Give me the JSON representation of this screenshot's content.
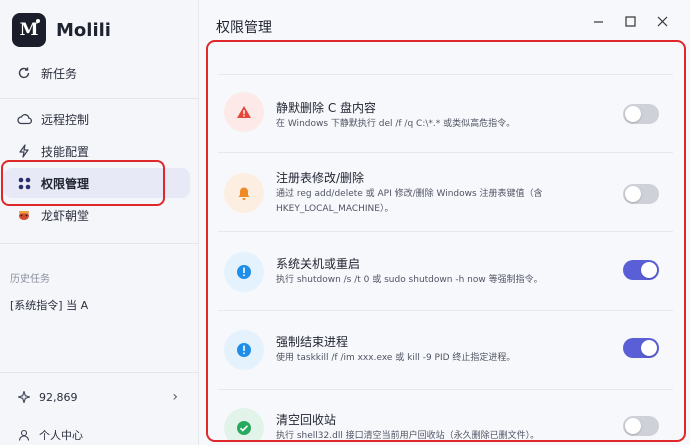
{
  "app": {
    "name": "Molili",
    "logo_letter": "M"
  },
  "sidebar": {
    "new_task": "新任务",
    "items": [
      {
        "label": "远程控制",
        "icon": "cloud-icon"
      },
      {
        "label": "技能配置",
        "icon": "lightning-icon"
      },
      {
        "label": "权限管理",
        "icon": "grid-dots-icon",
        "active": true
      },
      {
        "label": "龙虾朝堂",
        "icon": "lobster-icon"
      }
    ],
    "history_label": "历史任务",
    "history_items": [
      "[系统指令] 当 A"
    ],
    "credits": "92,869",
    "profile": "个人中心"
  },
  "header": {
    "title": "权限管理"
  },
  "window_controls": {
    "minimize": "—",
    "maximize": "☐",
    "close": "✕"
  },
  "permissions": [
    {
      "title": "静默删除 C 盘内容",
      "desc": "在 Windows 下静默执行 del /f /q C:\\*.* 或类似高危指令。",
      "icon": "warning-icon",
      "enabled": false
    },
    {
      "title": "注册表修改/删除",
      "desc": "通过 reg add/delete 或 API 修改/删除 Windows 注册表键值（含 HKEY_LOCAL_MACHINE）。",
      "icon": "bell-icon",
      "enabled": false
    },
    {
      "title": "系统关机或重启",
      "desc": "执行 shutdown /s /t 0 或 sudo shutdown -h now 等强制指令。",
      "icon": "info-icon",
      "enabled": true
    },
    {
      "title": "强制结束进程",
      "desc": "使用 taskkill /f /im xxx.exe 或 kill -9 PID 终止指定进程。",
      "icon": "info-icon",
      "enabled": true
    },
    {
      "title": "清空回收站",
      "desc": "执行 shell32.dll 接口清空当前用户回收站（永久删除已删文件）。",
      "icon": "check-icon",
      "enabled": false
    }
  ],
  "colors": {
    "accent": "#5a5fd8",
    "highlight": "#e0282a",
    "warning_bg": "#fde9e7",
    "warning": "#e5483b",
    "bell_bg": "#fdeee2",
    "bell": "#f08a24",
    "info_bg": "#e4f2fd",
    "info": "#1e8ee8",
    "check_bg": "#e2f4ea",
    "check": "#27a960"
  }
}
